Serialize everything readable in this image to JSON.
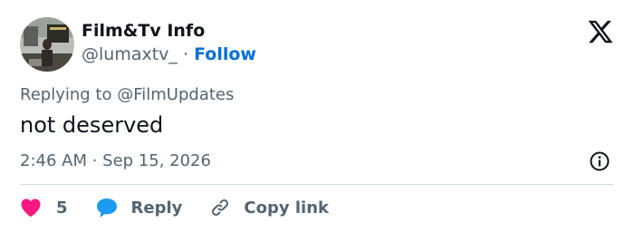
{
  "author": {
    "name": "Film&Tv Info",
    "handle": "@lumaxtv_",
    "separator": "·",
    "follow_label": "Follow"
  },
  "reply_context": {
    "prefix": "Replying to",
    "target": "@FilmUpdates"
  },
  "tweet": {
    "text": "not deserved",
    "timestamp": "2:46 AM · Sep 15, 2026"
  },
  "actions": {
    "like_count": "5",
    "reply_label": "Reply",
    "copy_link_label": "Copy link"
  },
  "icons": {
    "brand": "x-logo-icon",
    "info": "info-icon",
    "like": "heart-icon",
    "reply": "speech-bubble-icon",
    "copy": "link-icon"
  },
  "colors": {
    "link": "#006fd6",
    "like": "#f91880",
    "reply": "#1d9bf0",
    "muted": "#536471",
    "text": "#0f1419"
  }
}
